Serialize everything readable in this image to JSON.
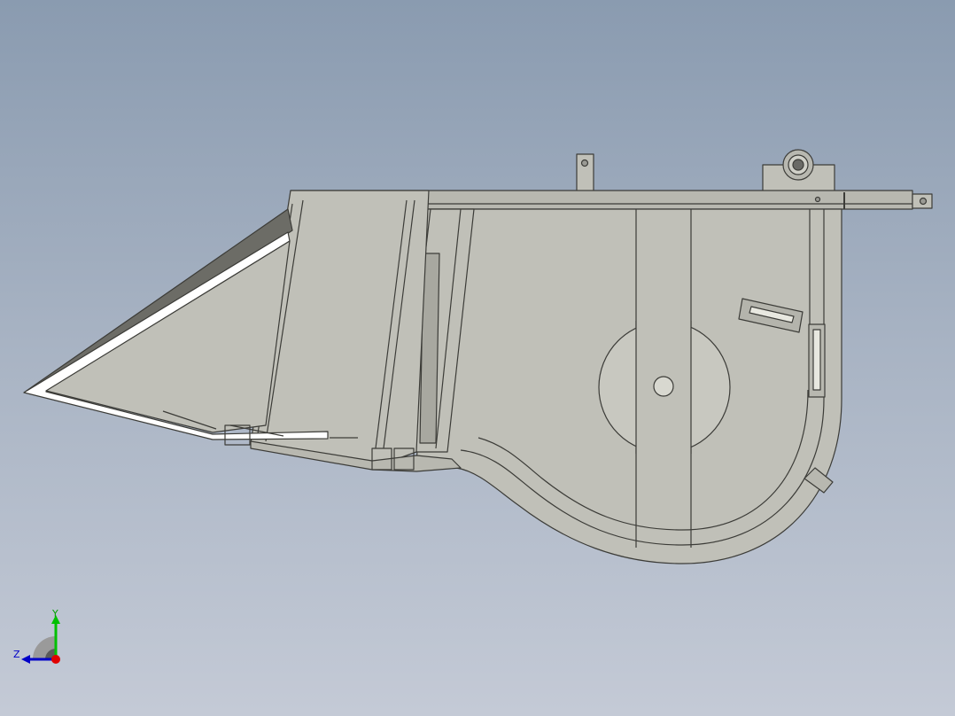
{
  "viewport": {
    "background_top": "#8a9bb0",
    "background_bottom": "#c4cad6"
  },
  "model": {
    "body_color": "#c0c0b8",
    "edge_color": "#3c3c38",
    "highlight_color": "#ffffff"
  },
  "triad": {
    "y_label": "Y",
    "z_label": "Z",
    "y_color": "#00c000",
    "z_color": "#0000c8",
    "x_color": "#e00000"
  }
}
